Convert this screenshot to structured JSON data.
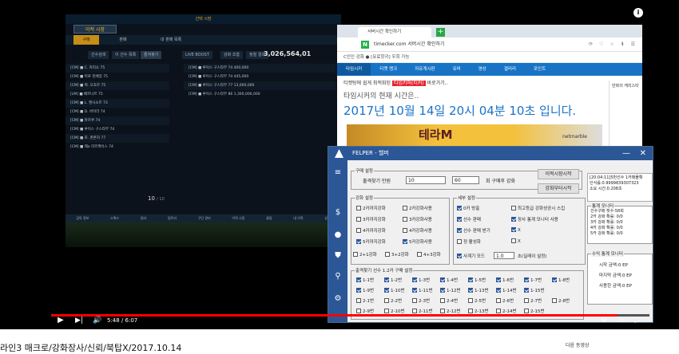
{
  "game": {
    "top": "선택 시장",
    "section": "이적 시장",
    "tabs": [
      "구매",
      "판매",
      "내 판매 목록"
    ],
    "subtabs": [
      "선수검색",
      "이 선수 목록",
      "즐겨찾기",
      "LIVE BOOST",
      "강화 조합",
      "정렬 결과"
    ],
    "money": "3,026,564,01",
    "left_rows": [
      "[CM] ■ C. 카리소 75",
      "[CM] ■ 미로 킹베일 75",
      "[CM] ■ 퀴. 오쵸르 75",
      "[LM] ■ 베르나르 75",
      "[CM] ■ L. 앤시소르 73",
      "[CM] ■ D. 바이라 74",
      "[CM] ■ 마르쿠 74",
      "[CM] ■ 루이스 구스타부 74",
      "[CM] ■ 조. 존존지 77",
      "[CM] ■ 제o 리르케이스 74"
    ],
    "right_rows": [
      "[CM] ■ 루이스 구스타부 74 400,000",
      "[CM] ■ 루이스 구스타부 74 445,000",
      "[CM] ■ 루이스 구스타부 77 13,000,000",
      "[CM] ■ 루이스 구스타부 86 1,300,000,000"
    ],
    "page": "10",
    "page_of": "/ 10",
    "bottom_nav": [
      "감독 정보",
      "스쿼드",
      "팀타",
      "팀트리",
      "구단 관리",
      "이적 시장",
      "클럽",
      "내 이적",
      "상점"
    ]
  },
  "browser": {
    "tab": "서버시간 확인하기",
    "url": "timecker.com 서버시간 확인하기",
    "bookmarks": "C인인 강화   ● [유료핫키] 우회 가능",
    "nav": [
      "타임시커",
      "티켓 랭크",
      "자유게시판",
      "유머",
      "영상",
      "갤러리",
      "포인트"
    ],
    "link_text": "티켓팅에 쉽게 최적화된 ",
    "link_red": "타임키퍼(티커)",
    "link_tail": " 바로가기..",
    "subtitle": "타임시커의 현재 시간은..",
    "time": "2017년 10월 14일 20시 04분 10초 입니다.",
    "side": "만화의 캐리스타",
    "ad_text": "테라M",
    "ad_brand": "netmarble"
  },
  "felper": {
    "title": "FELPER - 헬퍼",
    "buy_group": "구매 설정",
    "buy_label": "출격찾기 만원",
    "buy_value": "10",
    "buy_count": "60",
    "buy_tail": "회 구매후 강화",
    "btn_start": "이적시장시작",
    "btn_reinforce": "강화부터시작",
    "reinforce_group": "강화 설정",
    "detail_group": "세부 설정",
    "reinforce_rows": [
      {
        "l": "2카까지강화",
        "r": "2카강화사용",
        "rc": false
      },
      {
        "l": "3카까지강화",
        "r": "3카강화사용",
        "rc": false
      },
      {
        "l": "4카까지강화",
        "r": "4카강화사용",
        "rc": false
      },
      {
        "l": "5카까지강화",
        "r": "5카강화사용",
        "rc": true
      }
    ],
    "reinforce_extra": [
      "2+1강화",
      "3+2강화",
      "4+3강화"
    ],
    "detail_rows": [
      {
        "a": "0카 방출",
        "b": "최고등급 강화성공시 스킵"
      },
      {
        "a": "선수 판매",
        "b": "장사 통계 모니터 사용"
      },
      {
        "a": "선수 판매 받기",
        "b": "X"
      },
      {
        "a": "정 활성화",
        "b": "X"
      }
    ],
    "speed_label": "사계기 모드",
    "speed_value": "1.0",
    "speed_tail": "초(딜레이 설정)",
    "card_group": "출격찾기 선수 1.2카 구매 설정",
    "card_rows": [
      [
        "1-1번",
        "1-2번",
        "1-3번",
        "1-4번",
        "1-5번",
        "1-6번",
        "1-7번",
        "1-8번"
      ],
      [
        "1-9번",
        "1-10번",
        "1-11번",
        "1-12번",
        "1-13번",
        "1-14번",
        "1-15번"
      ],
      [
        "2-1번",
        "2-2번",
        "2-3번",
        "2-4번",
        "2-5번",
        "2-6번",
        "2-7번",
        "2-8번"
      ],
      [
        "2-9번",
        "2-10번",
        "2-11번",
        "2-12번",
        "2-13번",
        "2-14번",
        "2-15번"
      ]
    ],
    "log": [
      "[20:04:11]5번선수 1카매물확",
      "인식률:0.9999839307323",
      "소요 시간:0.208초"
    ],
    "stat_group": "통계 모니터",
    "stats": [
      "선수구매 횟수:58회",
      "2카 강화 확률: 0/0",
      "3카 강화 확률: 0/0",
      "4카 강화 확률: 0/0",
      "5카 강화 확률: 0/0"
    ],
    "sale_group": "수익 통계 모니터",
    "sale": [
      "시작 금액:0 EP",
      "마지막 금액:0 EP",
      "사용한 금액:0 EP"
    ]
  },
  "player": {
    "time": "5:48 / 6:07",
    "progress": 0.946
  },
  "page": {
    "video_title": "라인3 매크로/강화장사/신뢰/북탑X/2017.10.14",
    "next_label": "다음 동영상"
  }
}
